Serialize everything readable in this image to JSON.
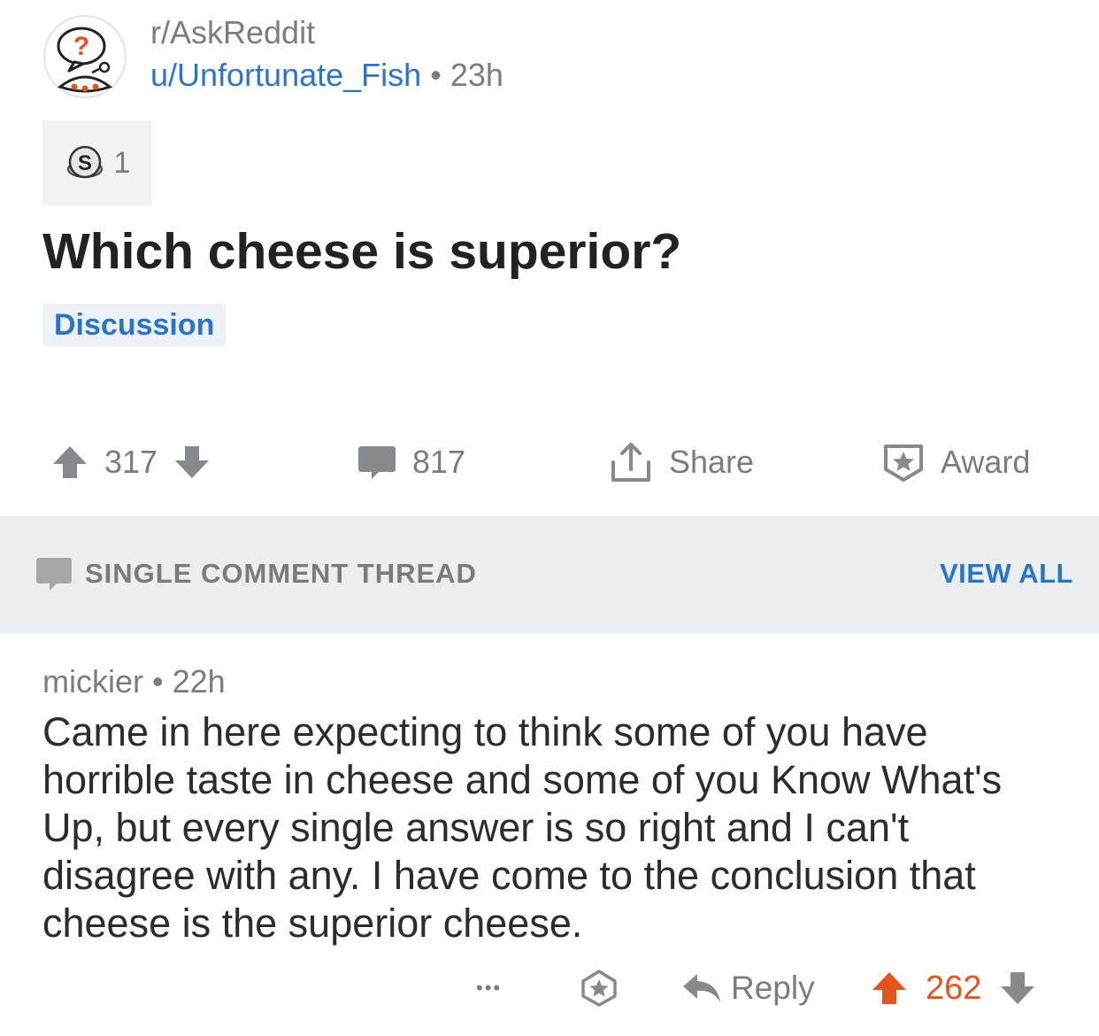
{
  "header": {
    "subreddit": "r/AskReddit",
    "author": "u/Unfortunate_Fish",
    "separator": "•",
    "age": "23h",
    "avatar_icon": "askreddit-snoo-icon"
  },
  "awards": {
    "icon": "silver-award-icon",
    "count": "1"
  },
  "post": {
    "title": "Which cheese is superior?",
    "flair": "Discussion"
  },
  "actions": {
    "upvote_icon": "upvote-arrow-icon",
    "score": "317",
    "downvote_icon": "downvote-arrow-icon",
    "comments_icon": "comment-bubble-icon",
    "comments_count": "817",
    "share_label": "Share",
    "share_icon": "share-icon",
    "award_label": "Award",
    "award_icon": "award-star-icon"
  },
  "thread": {
    "label": "SINGLE COMMENT THREAD",
    "view_all": "VIEW ALL"
  },
  "comment": {
    "author": "mickier",
    "separator": "•",
    "age": "22h",
    "body": "Came in here expecting to think some of you have horrible taste in cheese and some of you Know What's Up, but every single answer is so right and I can't disagree with any. I have come to the conclusion that cheese is the superior cheese.",
    "more_label": "•••",
    "reply_label": "Reply",
    "score": "262"
  },
  "colors": {
    "link_blue": "#2a75c7",
    "upvote_orange": "#e3541f",
    "meta_gray": "#7c7c7c",
    "banner_bg": "#eceef0"
  }
}
